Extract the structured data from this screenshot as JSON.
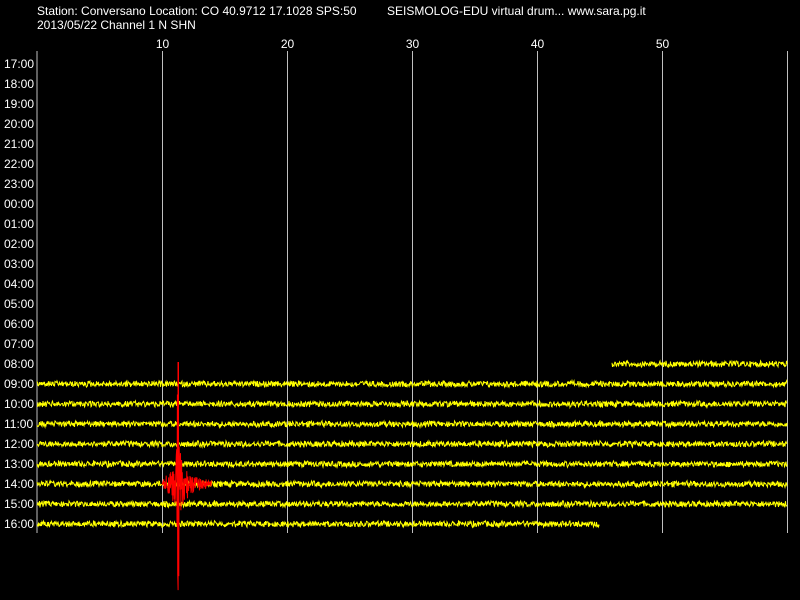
{
  "header": {
    "station_line": "Station: Conversano Location: CO 40.9712 17.1028 SPS:50",
    "date_line": "2013/05/22  Channel 1 N SHN",
    "app_line": "SEISMOLOG-EDU virtual drum... www.sara.pg.it"
  },
  "colors": {
    "background": "#000000",
    "grid": "#bfbfbf",
    "trace": "#ffff00",
    "event": "#ff0000",
    "text": "#ffffff"
  },
  "chart_data": {
    "type": "line",
    "title": "",
    "xlabel": "",
    "ylabel": "",
    "x_range_minutes": [
      0,
      60
    ],
    "x_tick_labels": [
      "10",
      "20",
      "30",
      "40",
      "50"
    ],
    "x_tick_values": [
      10,
      20,
      30,
      40,
      50
    ],
    "row_labels": [
      "17:00",
      "18:00",
      "19:00",
      "20:00",
      "21:00",
      "22:00",
      "23:00",
      "00:00",
      "01:00",
      "02:00",
      "03:00",
      "04:00",
      "05:00",
      "06:00",
      "07:00",
      "08:00",
      "09:00",
      "10:00",
      "11:00",
      "12:00",
      "13:00",
      "14:00",
      "15:00",
      "16:00"
    ],
    "traces": [
      {
        "row": "08:00",
        "start_minute": 46,
        "end_minute": 60
      },
      {
        "row": "09:00",
        "start_minute": 0,
        "end_minute": 60
      },
      {
        "row": "10:00",
        "start_minute": 0,
        "end_minute": 60
      },
      {
        "row": "11:00",
        "start_minute": 0,
        "end_minute": 60
      },
      {
        "row": "12:00",
        "start_minute": 0,
        "end_minute": 60
      },
      {
        "row": "13:00",
        "start_minute": 0,
        "end_minute": 60
      },
      {
        "row": "14:00",
        "start_minute": 0,
        "end_minute": 60
      },
      {
        "row": "15:00",
        "start_minute": 0,
        "end_minute": 60
      },
      {
        "row": "16:00",
        "start_minute": 0,
        "end_minute": 45
      }
    ],
    "event": {
      "row": "14:00",
      "start_minute": 10.0,
      "peak_minute": 11.3,
      "end_minute": 14.0,
      "peak_amplitude_rows": 6.1
    },
    "grid": true
  }
}
